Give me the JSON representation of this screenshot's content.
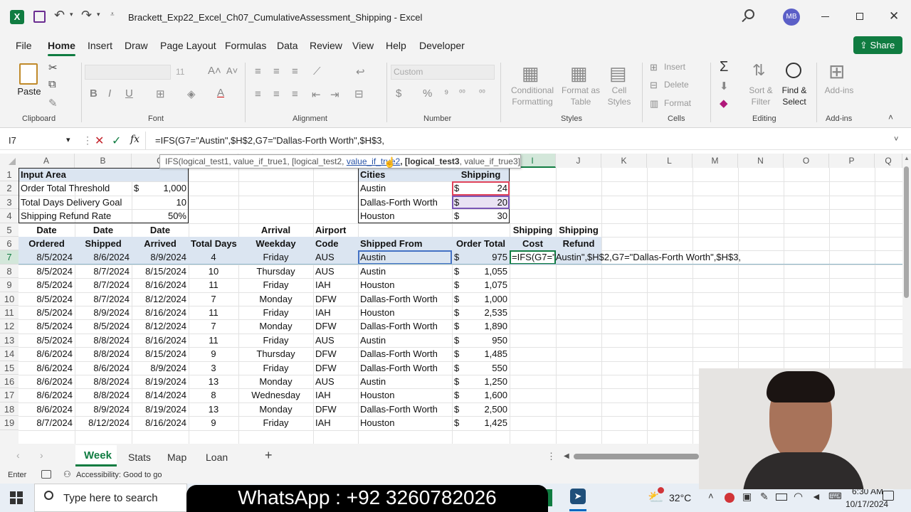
{
  "window": {
    "title": "Brackett_Exp22_Excel_Ch07_CumulativeAssessment_Shipping  -  Excel",
    "user_initials": "MB"
  },
  "menu": [
    "File",
    "Home",
    "Insert",
    "Draw",
    "Page Layout",
    "Formulas",
    "Data",
    "Review",
    "View",
    "Help",
    "Developer"
  ],
  "share_label": "Share",
  "ribbon": {
    "paste": "Paste",
    "font_size": "11",
    "number_format": "Custom",
    "conditional_formatting": [
      "Conditional",
      "Formatting"
    ],
    "format_as_table": [
      "Format as",
      "Table"
    ],
    "cell_styles": [
      "Cell",
      "Styles"
    ],
    "insert": "Insert",
    "delete": "Delete",
    "format": "Format",
    "sort_filter": [
      "Sort &",
      "Filter"
    ],
    "find_select": [
      "Find &",
      "Select"
    ],
    "addins": "Add-ins",
    "groups": [
      "Clipboard",
      "Font",
      "Alignment",
      "Number",
      "Styles",
      "Cells",
      "Editing",
      "Add-ins"
    ]
  },
  "formula_bar": {
    "name_box": "I7",
    "fx": "fx",
    "cancel_symbol": "✕",
    "enter_symbol": "✓",
    "formula": "=IFS(G7=\"Austin\",$H$2,G7=\"Dallas-Forth Worth\",$H$3,"
  },
  "tooltip": {
    "part1": "IFS(logical_test1, value_if_true1, [logical_test2, ",
    "active": "value_if_true2",
    "part3": ", [logical_test3",
    "part4": ", value_if_true3], ...)"
  },
  "columns": [
    "A",
    "B",
    "C",
    "D",
    "E",
    "F",
    "G",
    "H",
    "I",
    "J",
    "K",
    "L",
    "M",
    "N",
    "O",
    "P",
    "Q"
  ],
  "input_area": {
    "title": "Input Area",
    "rows": [
      {
        "label": "Order Total Threshold",
        "cur": "$",
        "value": "1,000"
      },
      {
        "label": "Total Days Delivery Goal",
        "cur": "",
        "value": "10"
      },
      {
        "label": "Shipping Refund Rate",
        "cur": "",
        "value": "50%"
      }
    ]
  },
  "cities_table": {
    "headers": [
      "Cities",
      "Shipping"
    ],
    "rows": [
      {
        "city": "Austin",
        "cur": "$",
        "cost": "24"
      },
      {
        "city": "Dallas-Forth Worth",
        "cur": "$",
        "cost": "20"
      },
      {
        "city": "Houston",
        "cur": "$",
        "cost": "30"
      }
    ]
  },
  "main_headers": {
    "line1": [
      "Date",
      "Date",
      "Date",
      "",
      "Arrival",
      "Airport",
      "",
      "",
      "Shipping",
      "Shipping"
    ],
    "line2": [
      "Ordered",
      "Shipped",
      "Arrived",
      "Total Days",
      "Weekday",
      "Code",
      "Shipped From",
      "Order Total",
      "Cost",
      "Refund"
    ]
  },
  "data_rows": [
    [
      "8/5/2024",
      "8/6/2024",
      "8/9/2024",
      "4",
      "Friday",
      "AUS",
      "Austin",
      "975"
    ],
    [
      "8/5/2024",
      "8/7/2024",
      "8/15/2024",
      "10",
      "Thursday",
      "AUS",
      "Austin",
      "1,055"
    ],
    [
      "8/5/2024",
      "8/7/2024",
      "8/16/2024",
      "11",
      "Friday",
      "IAH",
      "Houston",
      "1,075"
    ],
    [
      "8/5/2024",
      "8/7/2024",
      "8/12/2024",
      "7",
      "Monday",
      "DFW",
      "Dallas-Forth Worth",
      "1,000"
    ],
    [
      "8/5/2024",
      "8/9/2024",
      "8/16/2024",
      "11",
      "Friday",
      "IAH",
      "Houston",
      "2,535"
    ],
    [
      "8/5/2024",
      "8/5/2024",
      "8/12/2024",
      "7",
      "Monday",
      "DFW",
      "Dallas-Forth Worth",
      "1,890"
    ],
    [
      "8/5/2024",
      "8/8/2024",
      "8/16/2024",
      "11",
      "Friday",
      "AUS",
      "Austin",
      "950"
    ],
    [
      "8/6/2024",
      "8/8/2024",
      "8/15/2024",
      "9",
      "Thursday",
      "DFW",
      "Dallas-Forth Worth",
      "1,485"
    ],
    [
      "8/6/2024",
      "8/6/2024",
      "8/9/2024",
      "3",
      "Friday",
      "DFW",
      "Dallas-Forth Worth",
      "550"
    ],
    [
      "8/6/2024",
      "8/8/2024",
      "8/19/2024",
      "13",
      "Monday",
      "AUS",
      "Austin",
      "1,250"
    ],
    [
      "8/6/2024",
      "8/8/2024",
      "8/14/2024",
      "8",
      "Wednesday",
      "IAH",
      "Houston",
      "1,600"
    ],
    [
      "8/6/2024",
      "8/9/2024",
      "8/19/2024",
      "13",
      "Monday",
      "DFW",
      "Dallas-Forth Worth",
      "2,500"
    ],
    [
      "8/7/2024",
      "8/12/2024",
      "8/16/2024",
      "9",
      "Friday",
      "IAH",
      "Houston",
      "1,425"
    ]
  ],
  "editing_cell": "=IFS(G7=\"Austin\",$H$2,G7=\"Dallas-Forth Worth\",$H$3,",
  "currency": "$",
  "sheets": [
    "Week",
    "Stats",
    "Map",
    "Loan"
  ],
  "status": {
    "mode": "Enter",
    "accessibility": "Accessibility: Good to go"
  },
  "taskbar": {
    "search": "Type here to search",
    "banner": "WhatsApp : +92 3260782026",
    "temp": "32°C",
    "time": "6:30 AM",
    "date": "10/17/2024"
  }
}
